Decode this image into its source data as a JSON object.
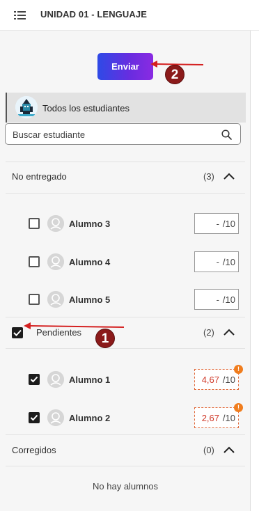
{
  "header": {
    "title": "UNIDAD 01 - LENGUAJE"
  },
  "toolbar": {
    "send_label": "Enviar"
  },
  "all_students": {
    "label": "Todos los estudiantes"
  },
  "search": {
    "placeholder": "Buscar estudiante",
    "value": ""
  },
  "sections": {
    "not_submitted": {
      "label": "No entregado",
      "count": "(3)",
      "students": [
        {
          "name": "Alumno 3",
          "grade": "-",
          "max": "/10"
        },
        {
          "name": "Alumno 4",
          "grade": "-",
          "max": "/10"
        },
        {
          "name": "Alumno 5",
          "grade": "-",
          "max": "/10"
        }
      ]
    },
    "pending": {
      "label": "Pendientes",
      "count": "(2)",
      "students": [
        {
          "name": "Alumno 1",
          "grade": "4,67",
          "max": "/10"
        },
        {
          "name": "Alumno 2",
          "grade": "2,67",
          "max": "/10"
        }
      ]
    },
    "graded": {
      "label": "Corregidos",
      "count": "(0)",
      "empty_text": "No hay alumnos"
    }
  },
  "annotations": {
    "badge_1": "1",
    "badge_2": "2",
    "warning_mark": "!"
  },
  "colors": {
    "button_gradient_start": "#2e4ae6",
    "button_gradient_end": "#8a2be2",
    "pending_border": "#e06a3b",
    "pending_grade": "#d03a2a",
    "warning": "#f07d1e",
    "annotation": "#8b1a1a"
  }
}
